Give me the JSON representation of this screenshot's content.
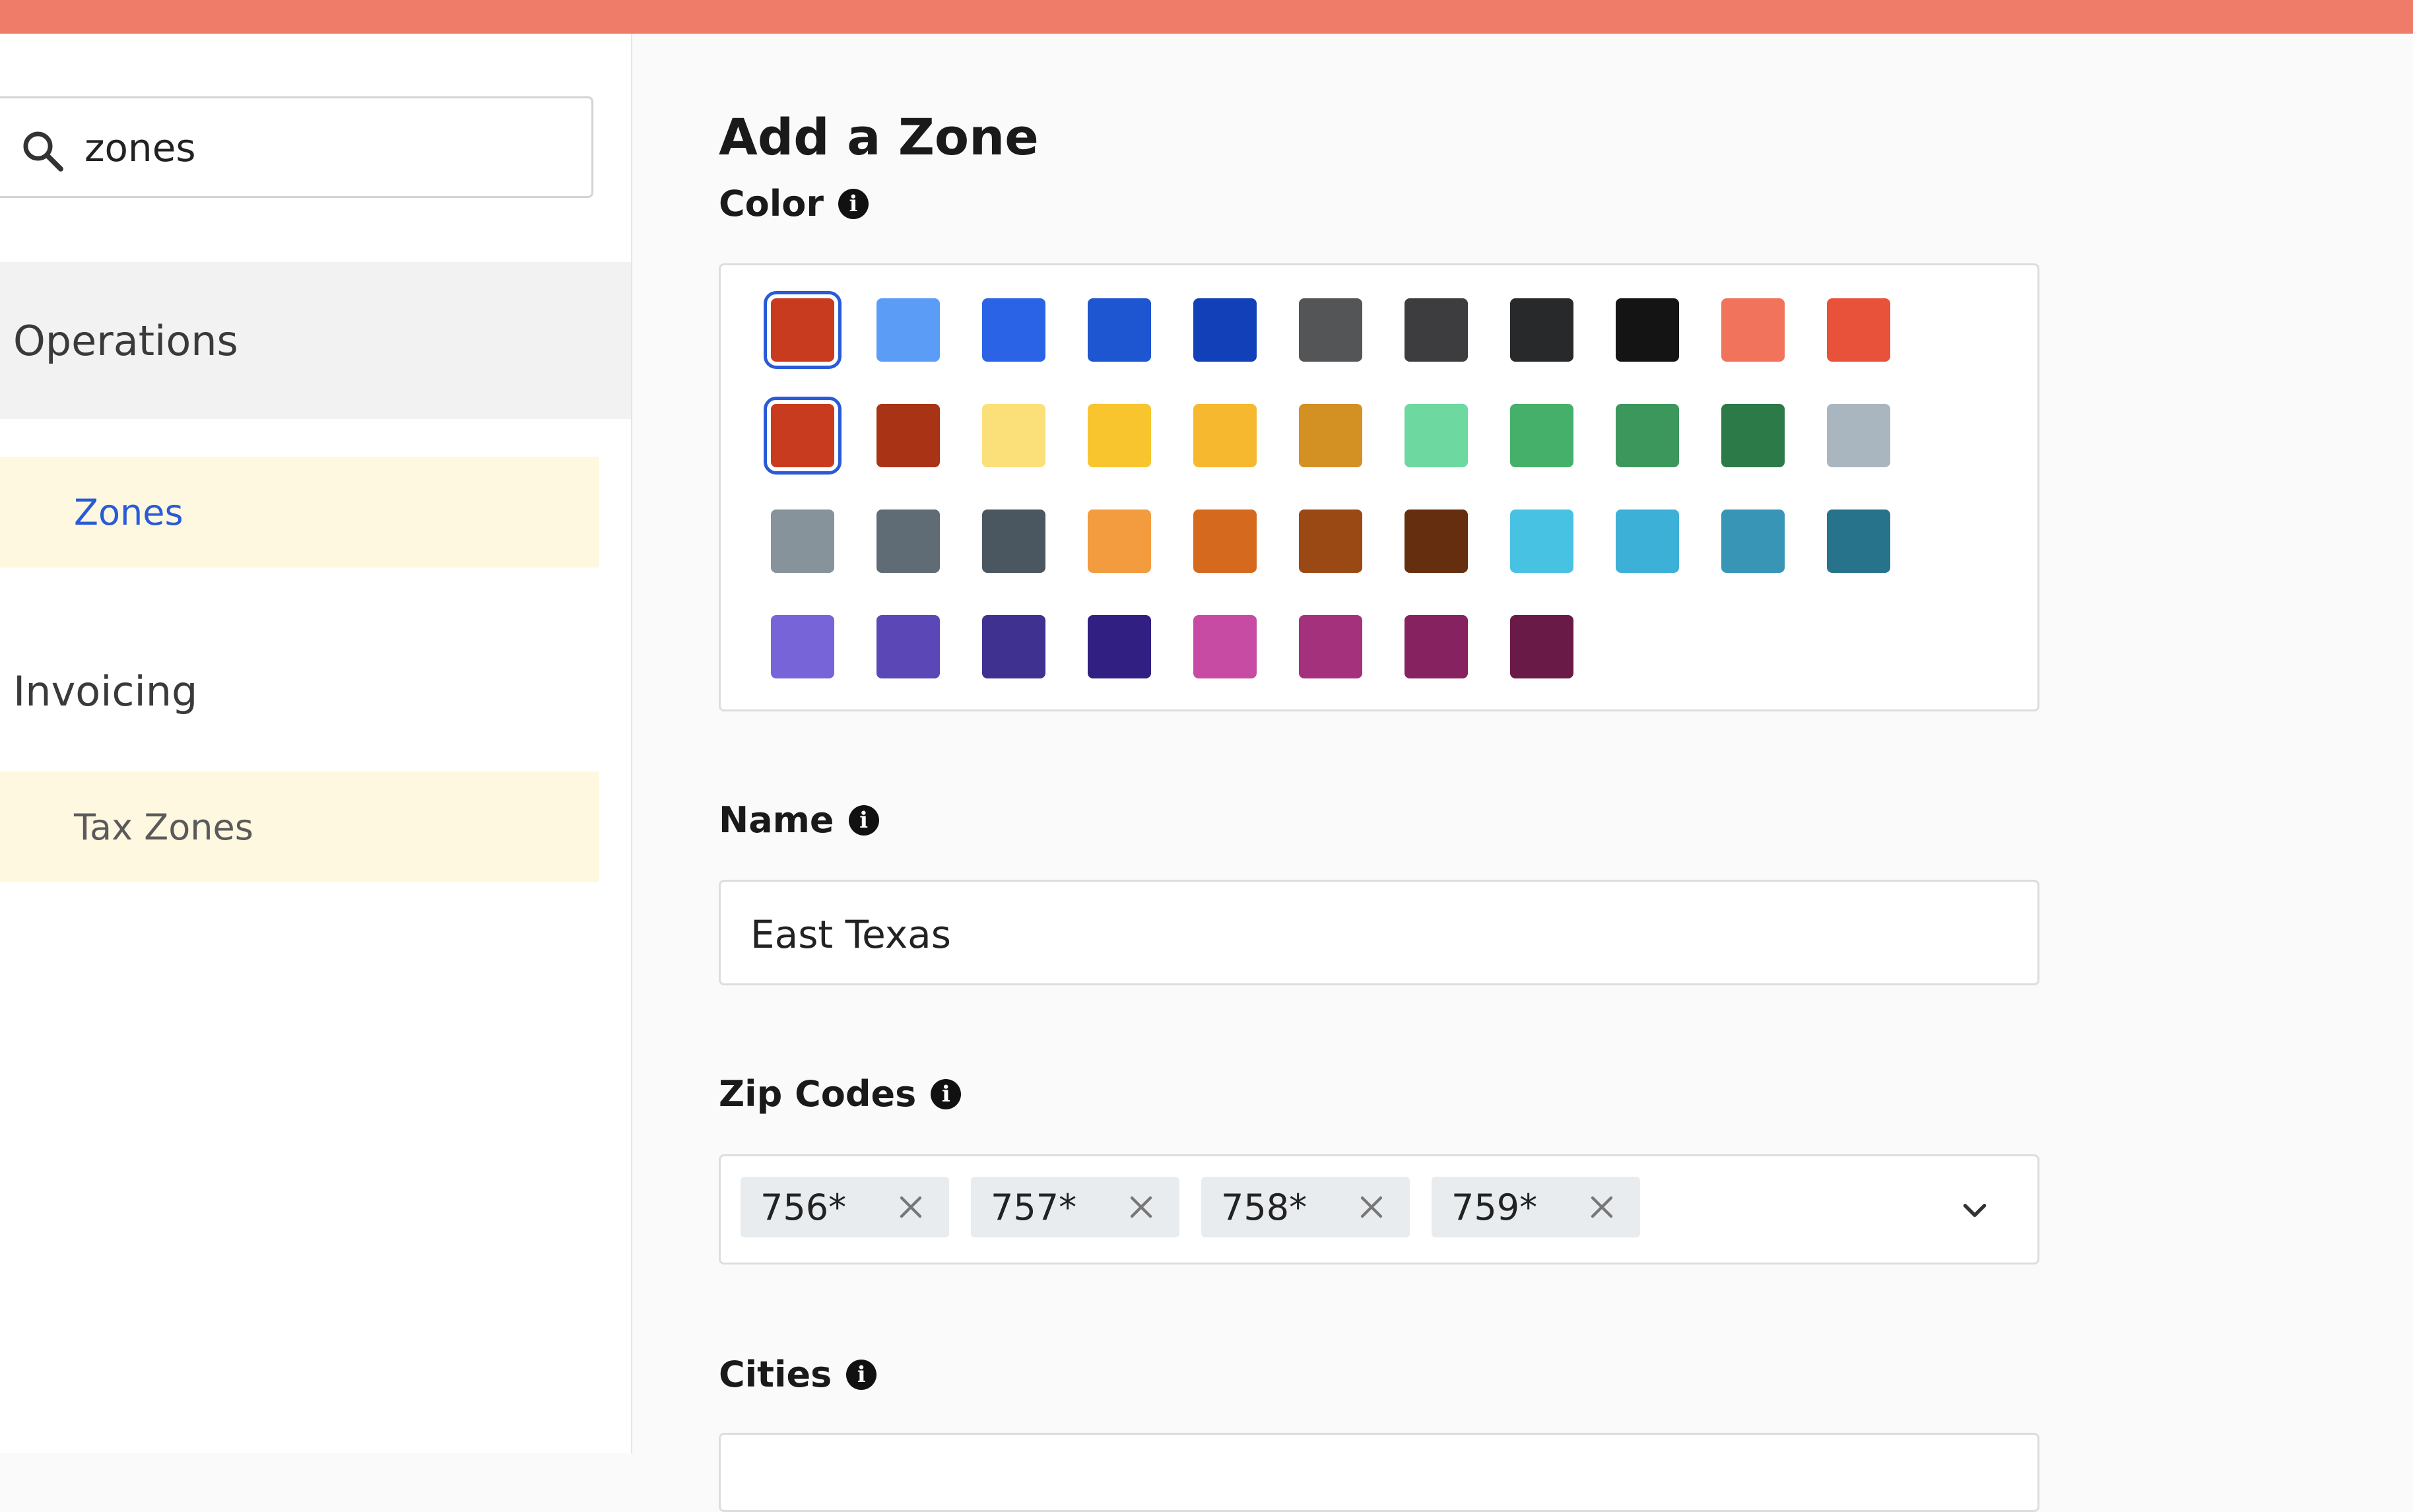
{
  "sidebar": {
    "search": {
      "value": "zones",
      "icon": "search-icon"
    },
    "groups": [
      {
        "label": "Operations",
        "items": [
          {
            "label": "Zones"
          }
        ]
      },
      {
        "label": "Invoicing",
        "items": [
          {
            "label": "Tax Zones"
          }
        ]
      }
    ]
  },
  "form": {
    "title": "Add a Zone",
    "color": {
      "label": "Color",
      "swatches": [
        [
          "#c93b1f",
          "#5b9cf7",
          "#2b63e6",
          "#1e55d0",
          "#1140b8",
          "#545557",
          "#3d3d3f",
          "#28292b",
          "#141414",
          "#f2735b",
          "#e8523a"
        ],
        [
          "#c93b1f",
          "#a83315",
          "#fbe07a",
          "#f8c52e",
          "#f6b82e",
          "#d39124",
          "#6dd89f",
          "#44b06a",
          "#3b975b",
          "#2c7a48",
          "#aab6bf"
        ],
        [
          "#86939b",
          "#5f6b75",
          "#4b5760",
          "#f39b3f",
          "#d56a1e",
          "#9b4914",
          "#652e0f",
          "#48c2e3",
          "#3db0d8",
          "#3895b5",
          "#27738c"
        ],
        [
          "#7864d9",
          "#5b47b5",
          "#3f3190",
          "#321f82",
          "#c74ba2",
          "#a3317b",
          "#85225f",
          "#6a1a47"
        ]
      ],
      "selected": [
        [
          0,
          0
        ],
        [
          1,
          0
        ]
      ]
    },
    "name": {
      "label": "Name",
      "value": "East Texas"
    },
    "zip_codes": {
      "label": "Zip Codes",
      "chips": [
        "756*",
        "757*",
        "758*",
        "759*"
      ]
    },
    "cities": {
      "label": "Cities"
    }
  }
}
